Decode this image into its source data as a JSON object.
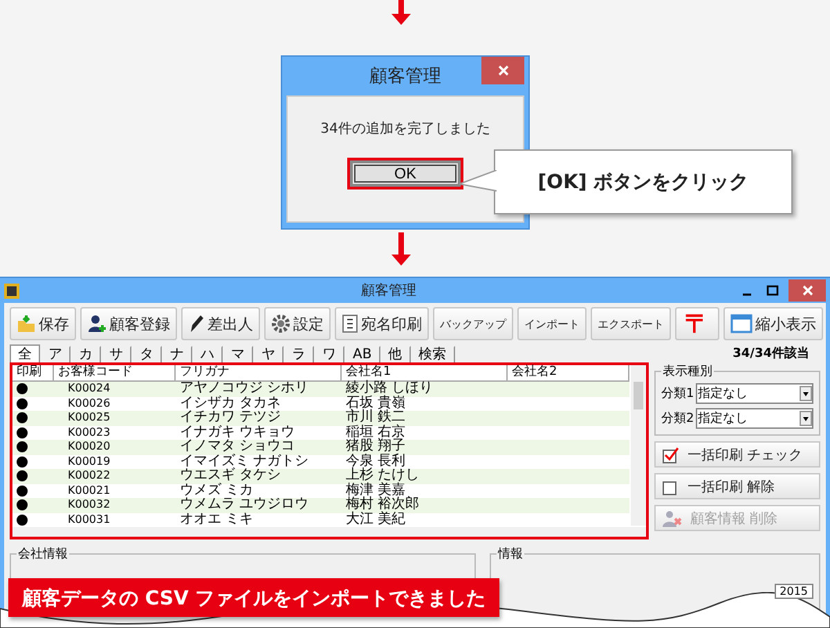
{
  "dialog": {
    "title": "顧客管理",
    "message": "34件の追加を完了しました",
    "button": "OK"
  },
  "callout": {
    "text": "[OK] ボタンをクリック"
  },
  "window": {
    "title": "顧客管理"
  },
  "toolbar": [
    {
      "kind": "large",
      "label": "保存"
    },
    {
      "kind": "large",
      "label": "顧客登録"
    },
    {
      "kind": "large",
      "label": "差出人"
    },
    {
      "kind": "large",
      "label": "設定"
    },
    {
      "kind": "large",
      "label": "宛名印刷"
    },
    {
      "kind": "small",
      "label": "バックアップ"
    },
    {
      "kind": "small",
      "label": "インポート"
    },
    {
      "kind": "small",
      "label": "エクスポート"
    },
    {
      "kind": "symbol",
      "label": "〒"
    },
    {
      "kind": "large",
      "label": "縮小表示"
    }
  ],
  "tabs": [
    {
      "label": "全",
      "selected": true
    },
    {
      "label": "ア",
      "selected": false
    },
    {
      "label": "カ",
      "selected": false
    },
    {
      "label": "サ",
      "selected": false
    },
    {
      "label": "タ",
      "selected": false
    },
    {
      "label": "ナ",
      "selected": false
    },
    {
      "label": "ハ",
      "selected": false
    },
    {
      "label": "マ",
      "selected": false
    },
    {
      "label": "ヤ",
      "selected": false
    },
    {
      "label": "ラ",
      "selected": false
    },
    {
      "label": "ワ",
      "selected": false
    },
    {
      "label": "AB",
      "selected": false
    },
    {
      "label": "他",
      "selected": false
    },
    {
      "label": "検索",
      "selected": false
    }
  ],
  "count": "34/34件該当",
  "table": {
    "columns": [
      "印刷",
      "お客様コード",
      "フリガナ",
      "会社名1",
      "会社名2"
    ],
    "rows": [
      {
        "print": true,
        "code": "K00024",
        "kana": "アヤノコウジ シホリ",
        "name": "綾小路 しほり"
      },
      {
        "print": true,
        "code": "K00026",
        "kana": "イシザカ タカネ",
        "name": "石坂 貴嶺"
      },
      {
        "print": true,
        "code": "K00025",
        "kana": "イチカワ テツジ",
        "name": "市川 鉄二"
      },
      {
        "print": true,
        "code": "K00023",
        "kana": "イナガキ ウキョウ",
        "name": "稲垣 右京"
      },
      {
        "print": true,
        "code": "K00020",
        "kana": "イノマタ ショウコ",
        "name": "猪股 翔子"
      },
      {
        "print": true,
        "code": "K00019",
        "kana": "イマイズミ ナガトシ",
        "name": "今泉 長利"
      },
      {
        "print": true,
        "code": "K00022",
        "kana": "ウエスギ タケシ",
        "name": "上杉 たけし"
      },
      {
        "print": true,
        "code": "K00021",
        "kana": "ウメズ ミカ",
        "name": "梅津 美嘉"
      },
      {
        "print": true,
        "code": "K00032",
        "kana": "ウメムラ ユウジロウ",
        "name": "梅村 裕次郎"
      },
      {
        "print": true,
        "code": "K00031",
        "kana": "オオエ ミキ",
        "name": "大江 美紀"
      }
    ]
  },
  "display_type": {
    "title": "表示種別",
    "filters": [
      {
        "label": "分類1",
        "value": "指定なし"
      },
      {
        "label": "分類2",
        "value": "指定なし"
      }
    ]
  },
  "side_buttons": [
    {
      "kind": "check",
      "label": "一括印刷 チェック",
      "disabled": false
    },
    {
      "kind": "uncheck",
      "label": "一括印刷 解除",
      "disabled": false
    },
    {
      "kind": "delete",
      "label": "顧客情報 削除",
      "disabled": true
    }
  ],
  "panels": [
    {
      "title": "会社情報"
    },
    {
      "title": "情報",
      "field": "2015"
    }
  ],
  "banner": {
    "text": "顧客データの CSV ファイルをインポートできました"
  }
}
